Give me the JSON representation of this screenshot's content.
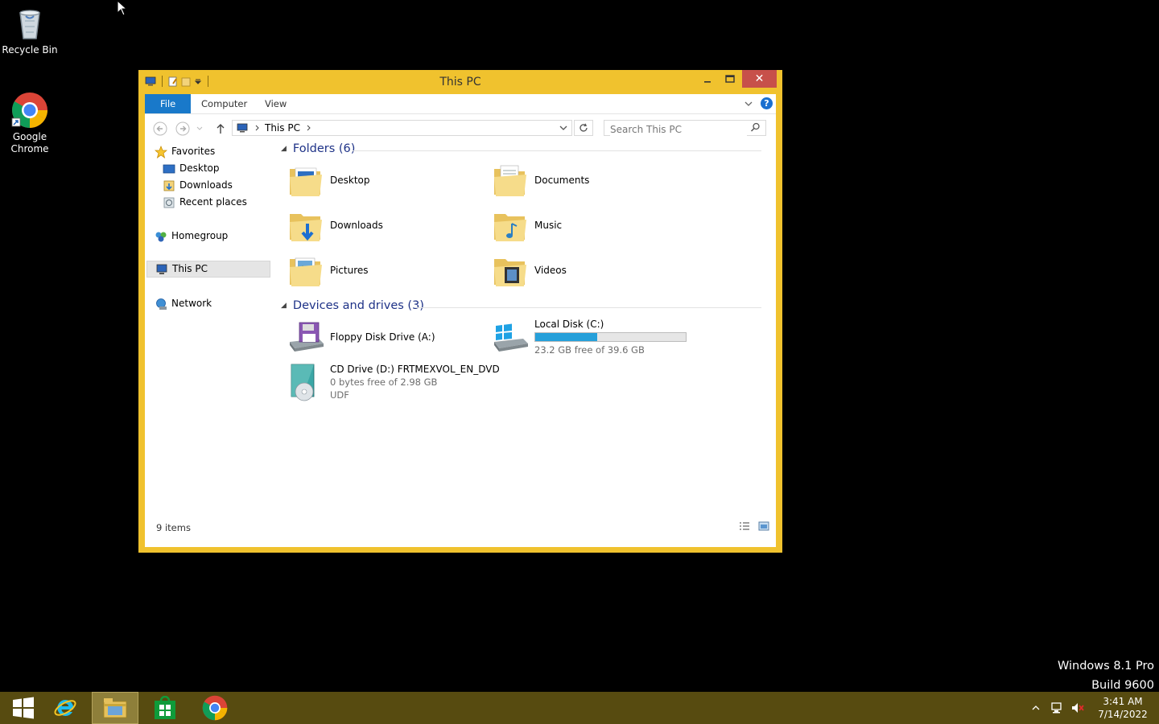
{
  "desktop": {
    "icons": [
      {
        "label": "Recycle Bin",
        "icon": "recycle-bin-icon"
      },
      {
        "label": "Google Chrome",
        "icon": "chrome-icon"
      }
    ],
    "watermark": {
      "line1": "Windows 8.1 Pro",
      "line2": "Build 9600"
    }
  },
  "window": {
    "title": "This PC",
    "accent": "#f0c22e",
    "close_color": "#c7504a",
    "controls": {
      "minimize": "minimize-icon",
      "maximize": "maximize-icon",
      "close": "✕"
    },
    "ribbon": {
      "tabs": [
        "File",
        "Computer",
        "View"
      ],
      "file_color": "#1979ca",
      "help": "?"
    },
    "address": {
      "crumb": "This PC"
    },
    "search": {
      "placeholder": "Search This PC"
    },
    "nav": {
      "favorites": "Favorites",
      "favorites_items": [
        "Desktop",
        "Downloads",
        "Recent places"
      ],
      "homegroup": "Homegroup",
      "this_pc": "This PC",
      "network": "Network"
    },
    "folders": {
      "header": "Folders (6)",
      "items": [
        "Desktop",
        "Documents",
        "Downloads",
        "Music",
        "Pictures",
        "Videos"
      ]
    },
    "drives": {
      "header": "Devices and drives (3)",
      "floppy": {
        "name": "Floppy Disk Drive (A:)"
      },
      "local": {
        "name": "Local Disk (C:)",
        "free_text": "23.2 GB free of 39.6 GB",
        "used_fraction": 0.414
      },
      "cd": {
        "name": "CD Drive (D:) FRTMEXVOL_EN_DVD",
        "free_text": "0 bytes free of 2.98 GB",
        "fs": "UDF"
      }
    },
    "status": {
      "count": "9 items"
    }
  },
  "taskbar": {
    "apps": [
      "start-icon",
      "internet-explorer-icon",
      "file-explorer-icon",
      "store-icon",
      "chrome-icon"
    ],
    "clock": {
      "time": "3:41 AM",
      "date": "7/14/2022"
    }
  }
}
